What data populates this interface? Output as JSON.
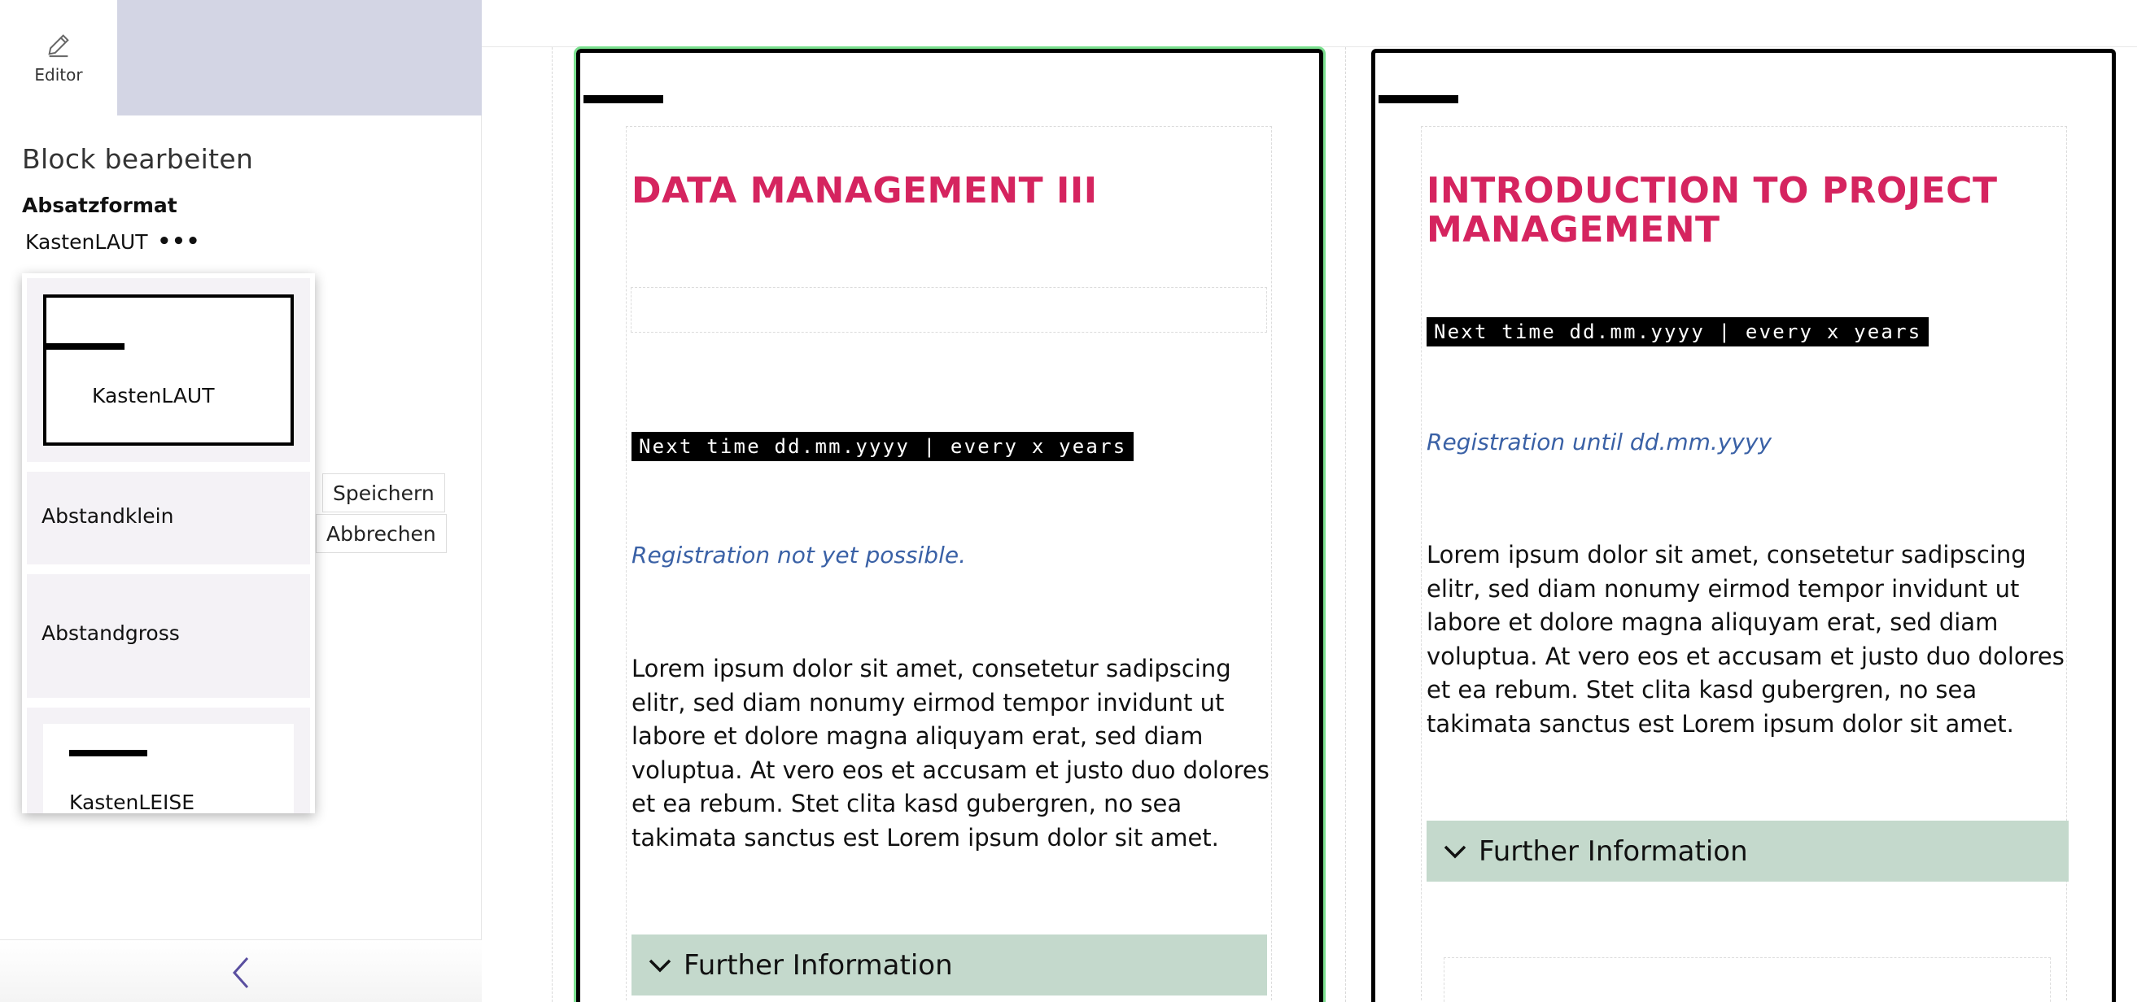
{
  "sidebar": {
    "editor_tab_label": "Editor",
    "icons": {
      "editor": "pencil-icon",
      "back": "chevron-left-icon"
    },
    "block_title": "Block bearbeiten",
    "format_label": "Absatzformat",
    "format_selected": "KastenLAUT",
    "format_more": "•••",
    "save_label": "Speichern",
    "cancel_label": "Abbrechen",
    "dropdown_options": [
      {
        "label": "KastenLAUT"
      },
      {
        "label": "Abstandklein"
      },
      {
        "label": "Abstandgross"
      },
      {
        "label": "KastenLEISE"
      }
    ]
  },
  "cards": [
    {
      "title": "DATA MANAGEMENT III",
      "badge": "Next time dd.mm.yyyy | every x years",
      "registration": "Registration not yet possible.",
      "body": "Lorem ipsum dolor sit amet, consetetur sadipscing elitr, sed diam nonumy eirmod tempor invidunt ut labore et dolore magna aliquyam erat, sed diam voluptua. At vero eos et accusam et justo duo dolores et ea rebum. Stet clita kasd gubergren, no sea takimata sanctus est Lorem ipsum dolor sit amet.",
      "further": "Further Information"
    },
    {
      "title": "INTRODUCTION TO PROJECT MANAGEMENT",
      "badge": "Next time dd.mm.yyyy | every x years",
      "registration": "Registration until dd.mm.yyyy",
      "body": "Lorem ipsum dolor sit amet, consetetur sadipscing elitr, sed diam nonumy eirmod tempor invidunt ut labore et dolore magna aliquyam erat, sed diam voluptua. At vero eos et accusam et justo duo dolores et ea rebum. Stet clita kasd gubergren, no sea takimata sanctus est Lorem ipsum dolor sit amet.",
      "further": "Further Information"
    }
  ],
  "colors": {
    "title": "#d5245f",
    "registration": "#3a61a6",
    "further_bg": "#c4d9cc",
    "sidebar_header": "#d3d5e4",
    "selected_outline": "#7be08f"
  }
}
